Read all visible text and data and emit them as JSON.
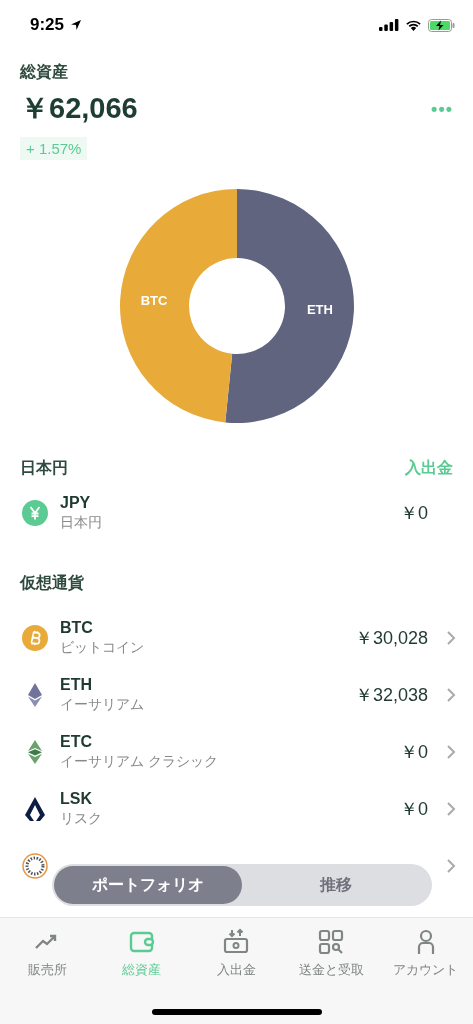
{
  "status_bar": {
    "time": "9:25"
  },
  "header": {
    "title": "総資産",
    "total": "￥62,066",
    "change": "+ 1.57%",
    "more": "•••"
  },
  "portfolio": {
    "chart_data": {
      "type": "donut",
      "categories": [
        "ETH",
        "BTC"
      ],
      "values": [
        51.6,
        48.4
      ],
      "colors": [
        "#60647f",
        "#e8ab3a"
      ]
    }
  },
  "fiat_section": {
    "title": "日本円",
    "action": "入出金"
  },
  "fiat": [
    {
      "symbol": "JPY",
      "name": "日本円",
      "value": "￥0"
    }
  ],
  "crypto_section": {
    "title": "仮想通貨"
  },
  "crypto": [
    {
      "symbol": "BTC",
      "name": "ビットコイン",
      "value": "￥30,028"
    },
    {
      "symbol": "ETH",
      "name": "イーサリアム",
      "value": "￥32,038"
    },
    {
      "symbol": "ETC",
      "name": "イーサリアム クラシック",
      "value": "￥0"
    },
    {
      "symbol": "LSK",
      "name": "リスク",
      "value": "￥0"
    }
  ],
  "segments": [
    {
      "label": "ポートフォリオ",
      "selected": true
    },
    {
      "label": "推移",
      "selected": false
    }
  ],
  "tabs": [
    {
      "label": "販売所",
      "selected": false
    },
    {
      "label": "総資産",
      "selected": true
    },
    {
      "label": "入出金",
      "selected": false
    },
    {
      "label": "送金と受取",
      "selected": false
    },
    {
      "label": "アカウント",
      "selected": false
    }
  ]
}
